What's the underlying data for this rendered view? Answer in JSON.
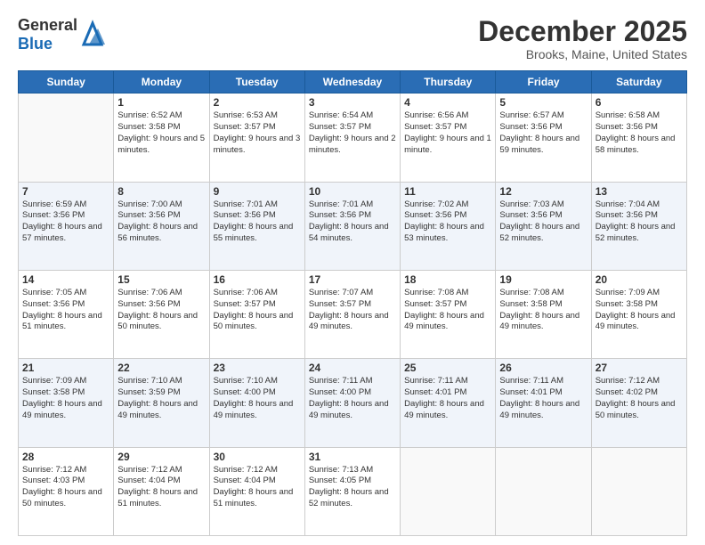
{
  "header": {
    "logo_general": "General",
    "logo_blue": "Blue",
    "month": "December 2025",
    "location": "Brooks, Maine, United States"
  },
  "days_of_week": [
    "Sunday",
    "Monday",
    "Tuesday",
    "Wednesday",
    "Thursday",
    "Friday",
    "Saturday"
  ],
  "weeks": [
    [
      {
        "day": "",
        "empty": true
      },
      {
        "day": "1",
        "sunrise": "6:52 AM",
        "sunset": "3:58 PM",
        "daylight": "9 hours and 5 minutes."
      },
      {
        "day": "2",
        "sunrise": "6:53 AM",
        "sunset": "3:57 PM",
        "daylight": "9 hours and 3 minutes."
      },
      {
        "day": "3",
        "sunrise": "6:54 AM",
        "sunset": "3:57 PM",
        "daylight": "9 hours and 2 minutes."
      },
      {
        "day": "4",
        "sunrise": "6:56 AM",
        "sunset": "3:57 PM",
        "daylight": "9 hours and 1 minute."
      },
      {
        "day": "5",
        "sunrise": "6:57 AM",
        "sunset": "3:56 PM",
        "daylight": "8 hours and 59 minutes."
      },
      {
        "day": "6",
        "sunrise": "6:58 AM",
        "sunset": "3:56 PM",
        "daylight": "8 hours and 58 minutes."
      }
    ],
    [
      {
        "day": "7",
        "sunrise": "6:59 AM",
        "sunset": "3:56 PM",
        "daylight": "8 hours and 57 minutes."
      },
      {
        "day": "8",
        "sunrise": "7:00 AM",
        "sunset": "3:56 PM",
        "daylight": "8 hours and 56 minutes."
      },
      {
        "day": "9",
        "sunrise": "7:01 AM",
        "sunset": "3:56 PM",
        "daylight": "8 hours and 55 minutes."
      },
      {
        "day": "10",
        "sunrise": "7:01 AM",
        "sunset": "3:56 PM",
        "daylight": "8 hours and 54 minutes."
      },
      {
        "day": "11",
        "sunrise": "7:02 AM",
        "sunset": "3:56 PM",
        "daylight": "8 hours and 53 minutes."
      },
      {
        "day": "12",
        "sunrise": "7:03 AM",
        "sunset": "3:56 PM",
        "daylight": "8 hours and 52 minutes."
      },
      {
        "day": "13",
        "sunrise": "7:04 AM",
        "sunset": "3:56 PM",
        "daylight": "8 hours and 52 minutes."
      }
    ],
    [
      {
        "day": "14",
        "sunrise": "7:05 AM",
        "sunset": "3:56 PM",
        "daylight": "8 hours and 51 minutes."
      },
      {
        "day": "15",
        "sunrise": "7:06 AM",
        "sunset": "3:56 PM",
        "daylight": "8 hours and 50 minutes."
      },
      {
        "day": "16",
        "sunrise": "7:06 AM",
        "sunset": "3:57 PM",
        "daylight": "8 hours and 50 minutes."
      },
      {
        "day": "17",
        "sunrise": "7:07 AM",
        "sunset": "3:57 PM",
        "daylight": "8 hours and 49 minutes."
      },
      {
        "day": "18",
        "sunrise": "7:08 AM",
        "sunset": "3:57 PM",
        "daylight": "8 hours and 49 minutes."
      },
      {
        "day": "19",
        "sunrise": "7:08 AM",
        "sunset": "3:58 PM",
        "daylight": "8 hours and 49 minutes."
      },
      {
        "day": "20",
        "sunrise": "7:09 AM",
        "sunset": "3:58 PM",
        "daylight": "8 hours and 49 minutes."
      }
    ],
    [
      {
        "day": "21",
        "sunrise": "7:09 AM",
        "sunset": "3:58 PM",
        "daylight": "8 hours and 49 minutes."
      },
      {
        "day": "22",
        "sunrise": "7:10 AM",
        "sunset": "3:59 PM",
        "daylight": "8 hours and 49 minutes."
      },
      {
        "day": "23",
        "sunrise": "7:10 AM",
        "sunset": "4:00 PM",
        "daylight": "8 hours and 49 minutes."
      },
      {
        "day": "24",
        "sunrise": "7:11 AM",
        "sunset": "4:00 PM",
        "daylight": "8 hours and 49 minutes."
      },
      {
        "day": "25",
        "sunrise": "7:11 AM",
        "sunset": "4:01 PM",
        "daylight": "8 hours and 49 minutes."
      },
      {
        "day": "26",
        "sunrise": "7:11 AM",
        "sunset": "4:01 PM",
        "daylight": "8 hours and 49 minutes."
      },
      {
        "day": "27",
        "sunrise": "7:12 AM",
        "sunset": "4:02 PM",
        "daylight": "8 hours and 50 minutes."
      }
    ],
    [
      {
        "day": "28",
        "sunrise": "7:12 AM",
        "sunset": "4:03 PM",
        "daylight": "8 hours and 50 minutes."
      },
      {
        "day": "29",
        "sunrise": "7:12 AM",
        "sunset": "4:04 PM",
        "daylight": "8 hours and 51 minutes."
      },
      {
        "day": "30",
        "sunrise": "7:12 AM",
        "sunset": "4:04 PM",
        "daylight": "8 hours and 51 minutes."
      },
      {
        "day": "31",
        "sunrise": "7:13 AM",
        "sunset": "4:05 PM",
        "daylight": "8 hours and 52 minutes."
      },
      {
        "day": "",
        "empty": true
      },
      {
        "day": "",
        "empty": true
      },
      {
        "day": "",
        "empty": true
      }
    ]
  ]
}
